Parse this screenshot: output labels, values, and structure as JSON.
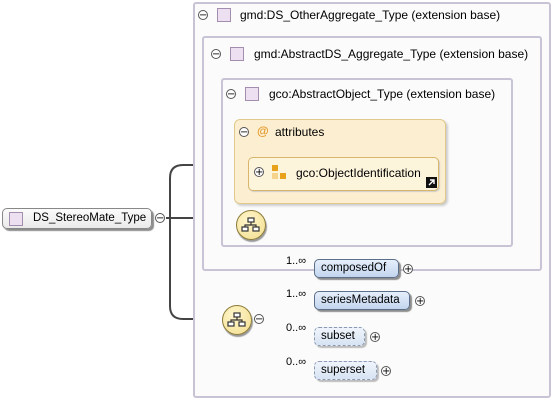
{
  "root": {
    "label": "DS_StereoMate_Type"
  },
  "ext_other_aggregate": {
    "title": "gmd:DS_OtherAggregate_Type (extension base)"
  },
  "ext_abstract_aggregate": {
    "title": "gmd:AbstractDS_Aggregate_Type (extension base)"
  },
  "ext_abstract_object": {
    "title": "gco:AbstractObject_Type (extension base)"
  },
  "attributes": {
    "title": "attributes",
    "at_symbol": "@",
    "group": {
      "label": "gco:ObjectIdentification"
    }
  },
  "toggles": {
    "expanded": "−",
    "collapsed": "+"
  },
  "elements": [
    {
      "label": "composedOf",
      "cardinality": "1..∞",
      "optional": false
    },
    {
      "label": "seriesMetadata",
      "cardinality": "1..∞",
      "optional": false
    },
    {
      "label": "subset",
      "cardinality": "0..∞",
      "optional": true
    },
    {
      "label": "superset",
      "cardinality": "0..∞",
      "optional": true
    }
  ],
  "colors": {
    "element_fill": "#c2d5ee",
    "attribute_fill": "#fcefd1",
    "connector": "#444444",
    "extension_border": "#c9c3d6"
  }
}
